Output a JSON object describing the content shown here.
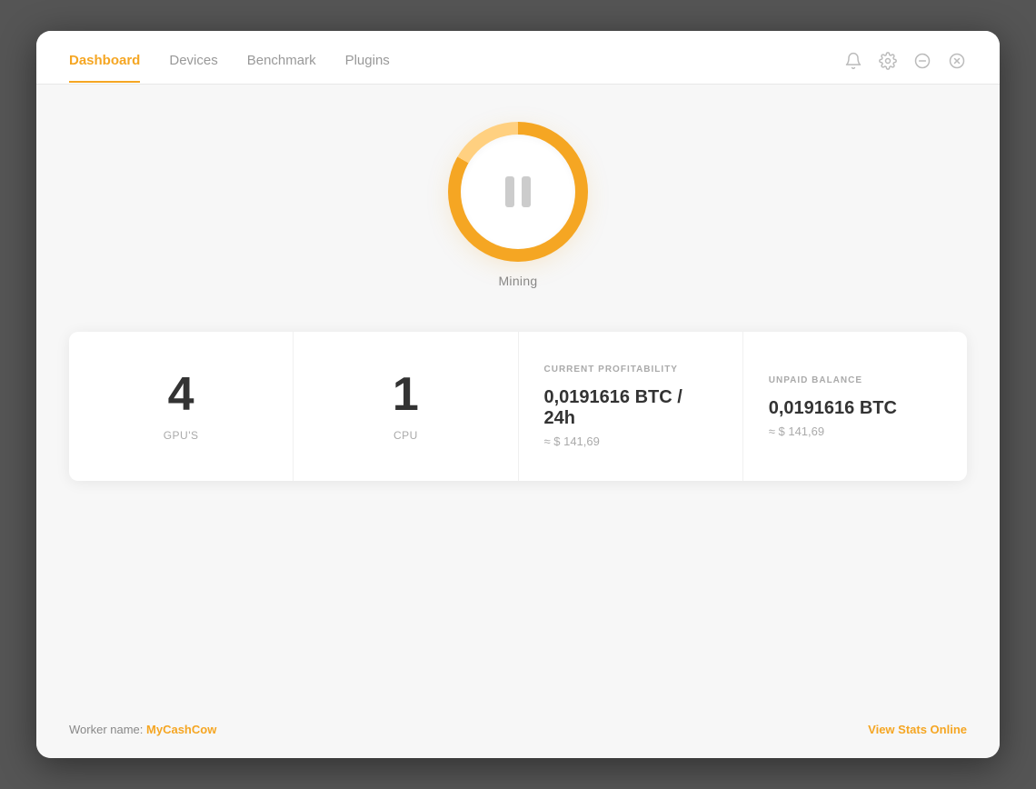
{
  "nav": {
    "items": [
      {
        "id": "dashboard",
        "label": "Dashboard",
        "active": true
      },
      {
        "id": "devices",
        "label": "Devices",
        "active": false
      },
      {
        "id": "benchmark",
        "label": "Benchmark",
        "active": false
      },
      {
        "id": "plugins",
        "label": "Plugins",
        "active": false
      }
    ]
  },
  "header_controls": {
    "notification_icon": "🔔",
    "settings_icon": "⚙",
    "minimize_icon": "⊖",
    "close_icon": "⊗"
  },
  "mining": {
    "button_label": "Mining",
    "status": "paused"
  },
  "stats": {
    "gpu_count": "4",
    "gpu_label": "GPU'S",
    "cpu_count": "1",
    "cpu_label": "CPU",
    "profitability": {
      "header": "CURRENT PROFITABILITY",
      "btc_value": "0,0191616 BTC / 24h",
      "usd_value": "≈ $ 141,69"
    },
    "unpaid_balance": {
      "header": "UNPAID BALANCE",
      "btc_value": "0,0191616 BTC",
      "usd_value": "≈ $ 141,69"
    }
  },
  "footer": {
    "worker_prefix": "Worker name: ",
    "worker_name": "MyCashCow",
    "view_stats_label": "View Stats Online"
  }
}
